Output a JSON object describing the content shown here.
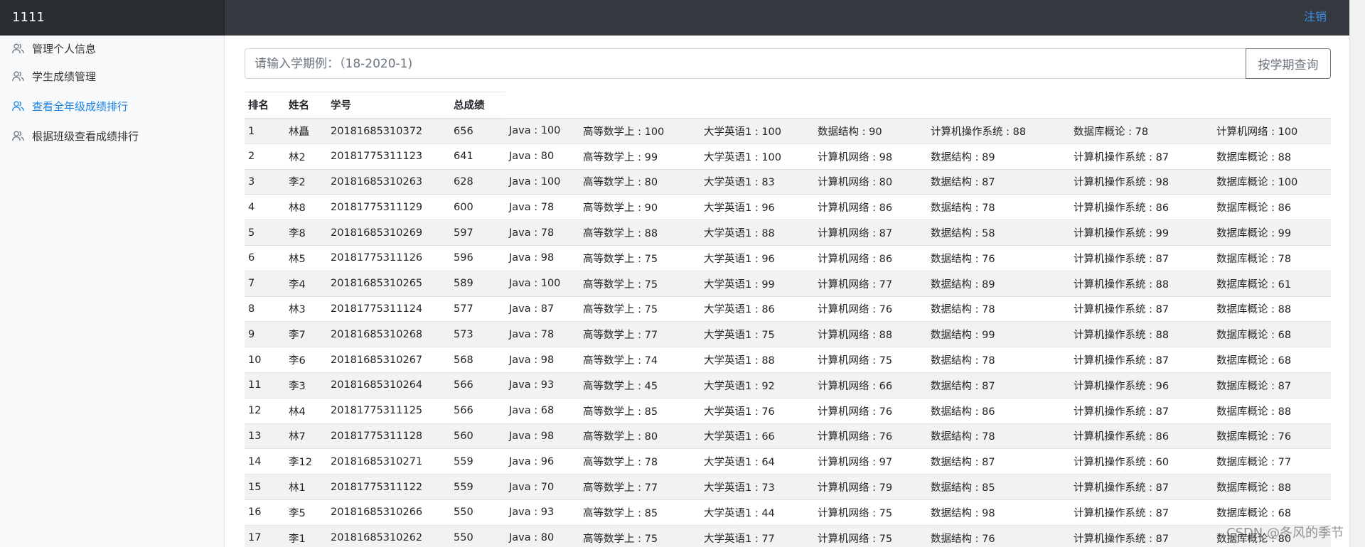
{
  "header": {
    "brand": "1111",
    "logout_label": "注销"
  },
  "sidebar": {
    "items": [
      {
        "label": "管理个人信息",
        "active": false
      },
      {
        "label": "学生成绩管理",
        "active": false
      },
      {
        "label": "查看全年级成绩排行",
        "active": true
      },
      {
        "label": "根据班级查看成绩排行",
        "active": false
      }
    ]
  },
  "search": {
    "placeholder": "请输入学期例：（18-2020-1)",
    "button_label": "按学期查询"
  },
  "table": {
    "columns": [
      "排名",
      "姓名",
      "学号",
      "总成绩"
    ],
    "rows": [
      {
        "rank": "1",
        "name": "林矗",
        "id": "20181685310372",
        "total": "656",
        "subjects": [
          "Java : 100",
          "高等数学上 : 100",
          "大学英语1 : 100",
          "数据结构 : 90",
          "计算机操作系统 : 88",
          "数据库概论 : 78",
          "计算机网络 : 100"
        ]
      },
      {
        "rank": "2",
        "name": "林2",
        "id": "20181775311123",
        "total": "641",
        "subjects": [
          "Java : 80",
          "高等数学上 : 99",
          "大学英语1 : 100",
          "计算机网络 : 98",
          "数据结构 : 89",
          "计算机操作系统 : 87",
          "数据库概论 : 88"
        ]
      },
      {
        "rank": "3",
        "name": "李2",
        "id": "20181685310263",
        "total": "628",
        "subjects": [
          "Java : 100",
          "高等数学上 : 80",
          "大学英语1 : 83",
          "计算机网络 : 80",
          "数据结构 : 87",
          "计算机操作系统 : 98",
          "数据库概论 : 100"
        ]
      },
      {
        "rank": "4",
        "name": "林8",
        "id": "20181775311129",
        "total": "600",
        "subjects": [
          "Java : 78",
          "高等数学上 : 90",
          "大学英语1 : 96",
          "计算机网络 : 86",
          "数据结构 : 78",
          "计算机操作系统 : 86",
          "数据库概论 : 86"
        ]
      },
      {
        "rank": "5",
        "name": "李8",
        "id": "20181685310269",
        "total": "597",
        "subjects": [
          "Java : 78",
          "高等数学上 : 88",
          "大学英语1 : 88",
          "计算机网络 : 87",
          "数据结构 : 58",
          "计算机操作系统 : 99",
          "数据库概论 : 99"
        ]
      },
      {
        "rank": "6",
        "name": "林5",
        "id": "20181775311126",
        "total": "596",
        "subjects": [
          "Java : 98",
          "高等数学上 : 75",
          "大学英语1 : 96",
          "计算机网络 : 86",
          "数据结构 : 76",
          "计算机操作系统 : 87",
          "数据库概论 : 78"
        ]
      },
      {
        "rank": "7",
        "name": "李4",
        "id": "20181685310265",
        "total": "589",
        "subjects": [
          "Java : 100",
          "高等数学上 : 75",
          "大学英语1 : 99",
          "计算机网络 : 77",
          "数据结构 : 89",
          "计算机操作系统 : 88",
          "数据库概论 : 61"
        ]
      },
      {
        "rank": "8",
        "name": "林3",
        "id": "20181775311124",
        "total": "577",
        "subjects": [
          "Java : 87",
          "高等数学上 : 75",
          "大学英语1 : 86",
          "计算机网络 : 76",
          "数据结构 : 78",
          "计算机操作系统 : 87",
          "数据库概论 : 88"
        ]
      },
      {
        "rank": "9",
        "name": "李7",
        "id": "20181685310268",
        "total": "573",
        "subjects": [
          "Java : 78",
          "高等数学上 : 77",
          "大学英语1 : 75",
          "计算机网络 : 88",
          "数据结构 : 99",
          "计算机操作系统 : 88",
          "数据库概论 : 68"
        ]
      },
      {
        "rank": "10",
        "name": "李6",
        "id": "20181685310267",
        "total": "568",
        "subjects": [
          "Java : 98",
          "高等数学上 : 74",
          "大学英语1 : 88",
          "计算机网络 : 75",
          "数据结构 : 78",
          "计算机操作系统 : 87",
          "数据库概论 : 68"
        ]
      },
      {
        "rank": "11",
        "name": "李3",
        "id": "20181685310264",
        "total": "566",
        "subjects": [
          "Java : 93",
          "高等数学上 : 45",
          "大学英语1 : 92",
          "计算机网络 : 66",
          "数据结构 : 87",
          "计算机操作系统 : 96",
          "数据库概论 : 87"
        ]
      },
      {
        "rank": "12",
        "name": "林4",
        "id": "20181775311125",
        "total": "566",
        "subjects": [
          "Java : 68",
          "高等数学上 : 85",
          "大学英语1 : 76",
          "计算机网络 : 76",
          "数据结构 : 86",
          "计算机操作系统 : 87",
          "数据库概论 : 88"
        ]
      },
      {
        "rank": "13",
        "name": "林7",
        "id": "20181775311128",
        "total": "560",
        "subjects": [
          "Java : 98",
          "高等数学上 : 80",
          "大学英语1 : 66",
          "计算机网络 : 76",
          "数据结构 : 78",
          "计算机操作系统 : 86",
          "数据库概论 : 76"
        ]
      },
      {
        "rank": "14",
        "name": "李12",
        "id": "20181685310271",
        "total": "559",
        "subjects": [
          "Java : 96",
          "高等数学上 : 78",
          "大学英语1 : 64",
          "计算机网络 : 97",
          "数据结构 : 87",
          "计算机操作系统 : 60",
          "数据库概论 : 77"
        ]
      },
      {
        "rank": "15",
        "name": "林1",
        "id": "20181775311122",
        "total": "559",
        "subjects": [
          "Java : 70",
          "高等数学上 : 77",
          "大学英语1 : 73",
          "计算机网络 : 79",
          "数据结构 : 85",
          "计算机操作系统 : 87",
          "数据库概论 : 88"
        ]
      },
      {
        "rank": "16",
        "name": "李5",
        "id": "20181685310266",
        "total": "550",
        "subjects": [
          "Java : 93",
          "高等数学上 : 85",
          "大学英语1 : 44",
          "计算机网络 : 75",
          "数据结构 : 98",
          "计算机操作系统 : 87",
          "数据库概论 : 68"
        ]
      },
      {
        "rank": "17",
        "name": "李1",
        "id": "20181685310262",
        "total": "550",
        "subjects": [
          "Java : 80",
          "高等数学上 : 75",
          "大学英语1 : 77",
          "计算机网络 : 75",
          "数据结构 : 76",
          "计算机操作系统 : 87",
          "数据库概论 : 80"
        ]
      }
    ]
  },
  "watermark": "CSDN @冬风的季节",
  "icons": {
    "nav": "users-icon"
  },
  "colors": {
    "topbar": "#343a40",
    "brand_bg": "#292d32",
    "active_link": "#1a82e2",
    "logout": "#3b8ee8"
  }
}
